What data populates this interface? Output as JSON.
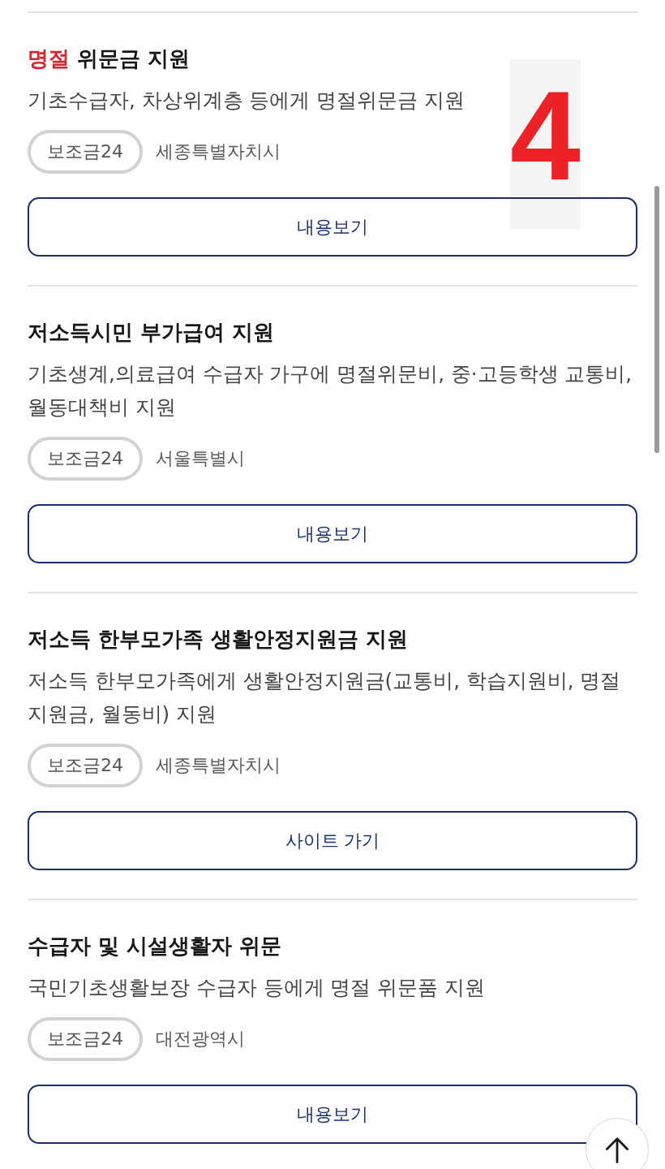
{
  "step_marker": "4",
  "results": [
    {
      "keyword": "명절",
      "title": "위문금 지원",
      "description": "기초수급자, 차상위계층 등에게 명절위문금 지원",
      "tag": "보조금24",
      "region": "세종특별자치시",
      "button": "내용보기"
    },
    {
      "title": "저소득시민 부가급여 지원",
      "description": "기초생계,의료급여 수급자 가구에 명절위문비, 중·고등학생 교통비, 월동대책비 지원",
      "tag": "보조금24",
      "region": "서울특별시",
      "button": "내용보기"
    },
    {
      "title": "저소득 한부모가족 생활안정지원금 지원",
      "description": "저소득 한부모가족에게 생활안정지원금(교통비, 학습지원비, 명절지원금, 월동비) 지원",
      "tag": "보조금24",
      "region": "세종특별자치시",
      "button": "사이트 가기"
    },
    {
      "title": "수급자 및 시설생활자 위문",
      "description": "국민기초생활보장 수급자 등에게 명절 위문품 지원",
      "tag": "보조금24",
      "region": "대전광역시",
      "button": "내용보기"
    }
  ]
}
